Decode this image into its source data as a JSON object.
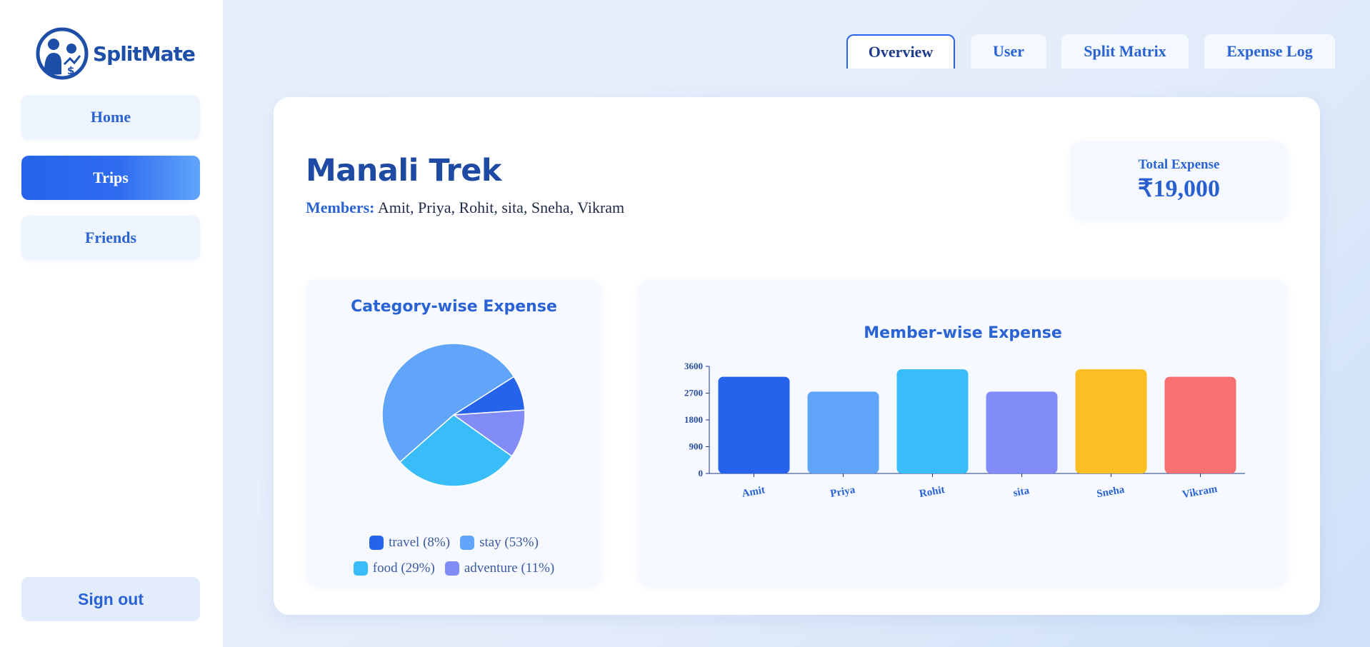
{
  "app": {
    "name": "SplitMate"
  },
  "sidebar": {
    "items": [
      {
        "label": "Home",
        "active": false
      },
      {
        "label": "Trips",
        "active": true
      },
      {
        "label": "Friends",
        "active": false
      }
    ],
    "signout_label": "Sign out"
  },
  "tabs": [
    {
      "label": "Overview",
      "active": true
    },
    {
      "label": "User",
      "active": false
    },
    {
      "label": "Split Matrix",
      "active": false
    },
    {
      "label": "Expense Log",
      "active": false
    }
  ],
  "trip": {
    "title": "Manali Trek",
    "members_label": "Members:",
    "members": "Amit, Priya, Rohit, sita, Sneha, Vikram",
    "total_label": "Total Expense",
    "total_value": "₹19,000"
  },
  "colors": {
    "accent": "#2563eb",
    "travel": "#2563eb",
    "stay": "#60a5fa",
    "food": "#38bdf8",
    "adventure": "#818cf8"
  },
  "chart_data": [
    {
      "type": "pie",
      "title": "Category-wise Expense",
      "slices": [
        {
          "label": "travel",
          "percent": 8,
          "legend": "travel (8%)",
          "color": "#2563eb"
        },
        {
          "label": "adventure",
          "percent": 11,
          "legend": "adventure (11%)",
          "color": "#818cf8"
        },
        {
          "label": "food",
          "percent": 29,
          "legend": "food (29%)",
          "color": "#38bdf8"
        },
        {
          "label": "stay",
          "percent": 53,
          "legend": "stay (53%)",
          "color": "#60a5fa"
        }
      ],
      "legend_rows": [
        [
          "travel (8%)",
          "stay (53%)"
        ],
        [
          "food (29%)",
          "adventure (11%)"
        ]
      ]
    },
    {
      "type": "bar",
      "title": "Member-wise Expense",
      "categories": [
        "Amit",
        "Priya",
        "Rohit",
        "sita",
        "Sneha",
        "Vikram"
      ],
      "values": [
        3250,
        2750,
        3500,
        2750,
        3500,
        3250
      ],
      "colors": [
        "#2563eb",
        "#60a5fa",
        "#38bdf8",
        "#818cf8",
        "#fbbf24",
        "#f87171"
      ],
      "yticks": [
        0,
        900,
        1800,
        2700,
        3600
      ],
      "ylim": [
        0,
        3600
      ],
      "xlabel": "",
      "ylabel": ""
    }
  ]
}
